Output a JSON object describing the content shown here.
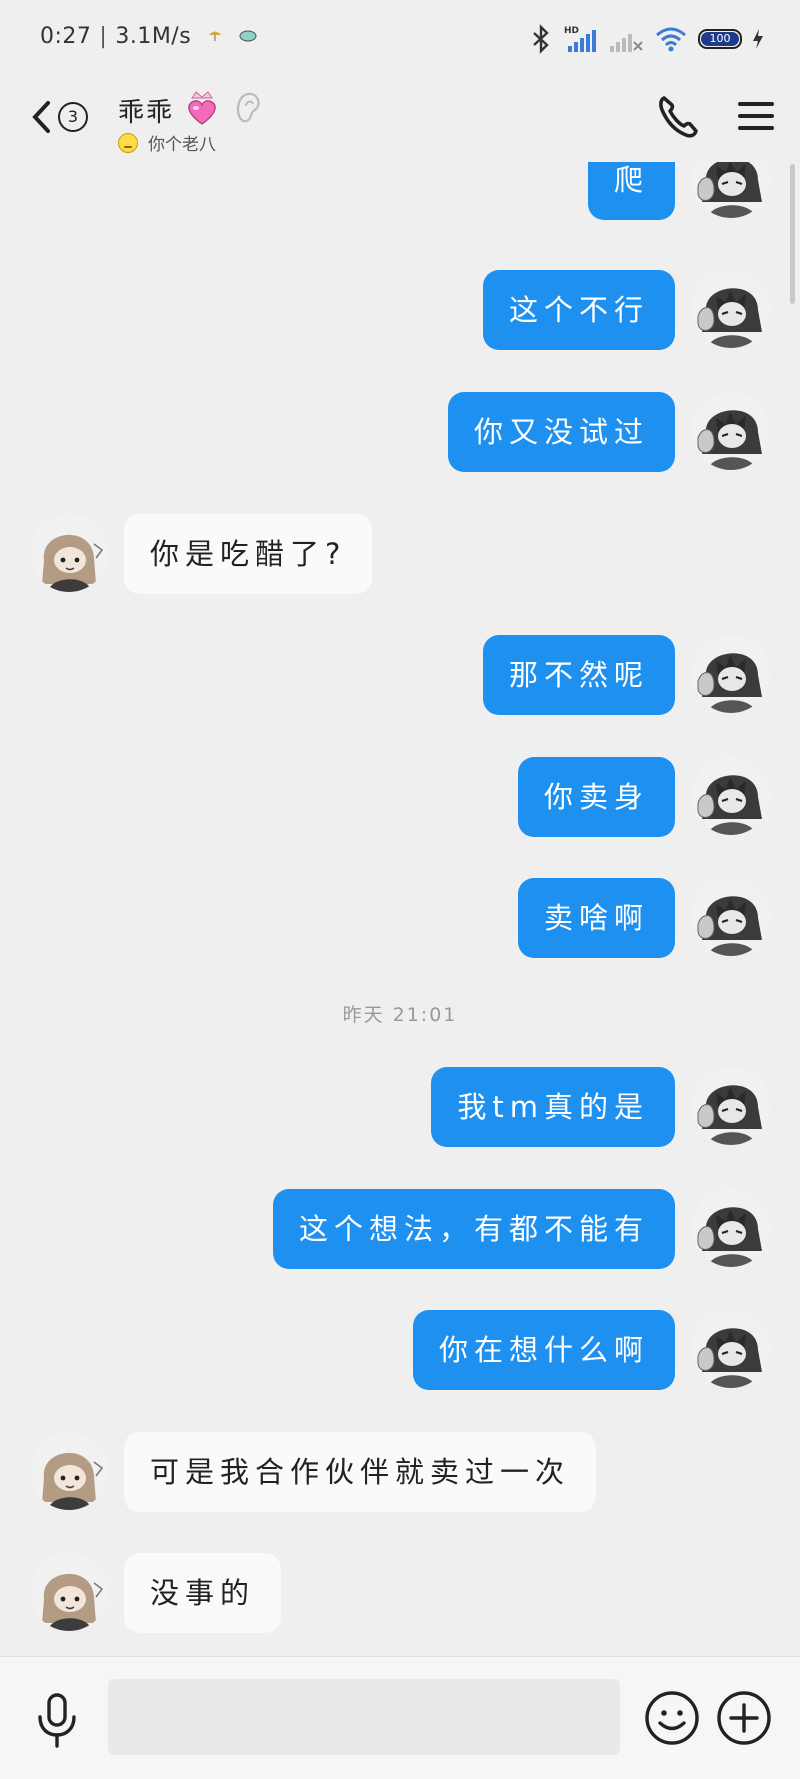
{
  "status_bar": {
    "time": "0:27",
    "network_speed": "3.1M/s",
    "battery_level": "100",
    "icons": [
      "mushroom-icon",
      "cloud-icon",
      "bluetooth-icon",
      "hd-signal-icon",
      "signal-no-sim-icon",
      "wifi-icon",
      "battery-icon",
      "charging-icon"
    ]
  },
  "header": {
    "unread_count": "3",
    "contact_name": "乖乖",
    "contact_status": "你个老八",
    "icons": [
      "back-chevron-icon",
      "heart-crown-icon",
      "ear-icon",
      "phone-icon",
      "menu-icon"
    ]
  },
  "colors": {
    "outgoing_bubble": "#1e90f0",
    "incoming_bubble": "#fafafa",
    "background": "#efefef"
  },
  "messages": [
    {
      "dir": "out",
      "text": "爬"
    },
    {
      "dir": "out",
      "text": "这个不行"
    },
    {
      "dir": "out",
      "text": "你又没试过"
    },
    {
      "dir": "in",
      "text": "你是吃醋了?"
    },
    {
      "dir": "out",
      "text": "那不然呢"
    },
    {
      "dir": "out",
      "text": "你卖身"
    },
    {
      "dir": "out",
      "text": "卖啥啊"
    },
    {
      "dir": "time",
      "text": "昨天 21:01"
    },
    {
      "dir": "out",
      "text": "我tm真的是"
    },
    {
      "dir": "out",
      "text": "这个想法，有都不能有"
    },
    {
      "dir": "out",
      "text": "你在想什么啊"
    },
    {
      "dir": "in",
      "text": "可是我合作伙伴就卖过一次"
    },
    {
      "dir": "in",
      "text": "没事的"
    }
  ],
  "input_bar": {
    "placeholder": "",
    "icons": [
      "microphone-icon",
      "smiley-icon",
      "plus-icon"
    ]
  }
}
